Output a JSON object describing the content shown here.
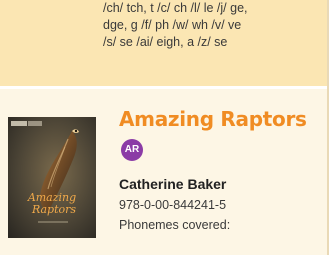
{
  "top_entry": {
    "phoneme_lines": [
      "/ch/ tch, t /c/ ch /l/ le /j/ ge,",
      "dge, g /f/ ph /w/ wh /v/ ve",
      "/s/ se /ai/ eigh, a /z/ se"
    ]
  },
  "book": {
    "title": "Amazing Raptors",
    "badge": "AR",
    "author": "Catherine Baker",
    "isbn": "978-0-00-844241-5",
    "phonemes_label": "Phonemes covered:",
    "cover": {
      "title_lines": [
        "Amazing",
        "Raptors"
      ]
    }
  },
  "colors": {
    "title": "#f08c23",
    "badge": "#8b3ba6",
    "top_cell_bg": "#fbe6b3",
    "page_bg": "#fdf6e5"
  }
}
